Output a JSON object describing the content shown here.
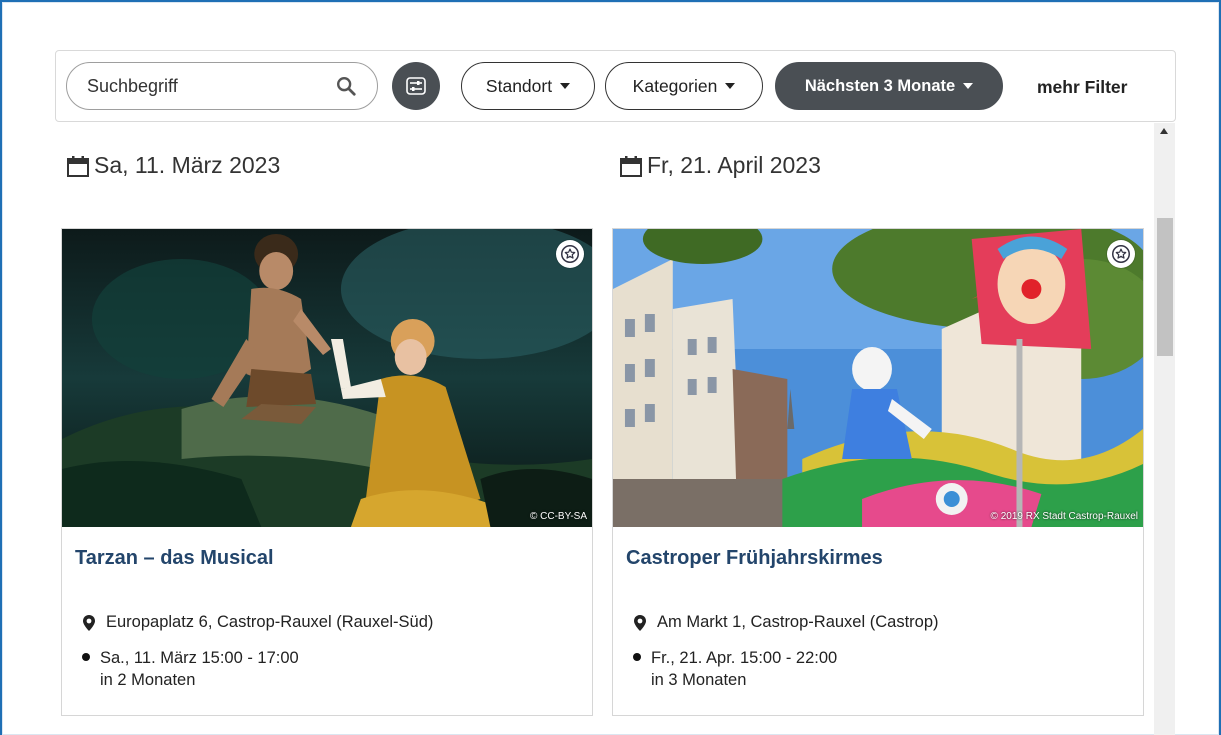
{
  "filters": {
    "search_placeholder": "Suchbegriff",
    "location_label": "Standort",
    "category_label": "Kategorien",
    "period_label": "Nächsten 3 Monate",
    "more_filters_label": "mehr Filter",
    "active_pill_color": "#4a4f54"
  },
  "events": [
    {
      "date_header": "Sa, 11. März 2023",
      "title": "Tarzan – das Musical",
      "address": "Europaplatz 6, Castrop-Rauxel (Rauxel-Süd)",
      "time": "Sa., 11. März 15:00 - 17:00",
      "relative": "in 2 Monaten",
      "copyright": "© CC-BY-SA",
      "image_icon": "musical-stage-photo"
    },
    {
      "date_header": "Fr, 21. April 2023",
      "title": "Castroper Frühjahrskirmes",
      "address": "Am Markt 1, Castrop-Rauxel (Castrop)",
      "time": "Fr., 21. Apr. 15:00 - 22:00",
      "relative": "in 3 Monaten",
      "copyright": "© 2019 RX Stadt Castrop-Rauxel",
      "image_icon": "fair-ride-photo"
    }
  ],
  "colors": {
    "title": "#23456b",
    "frame_border": "#1f6fb5"
  }
}
